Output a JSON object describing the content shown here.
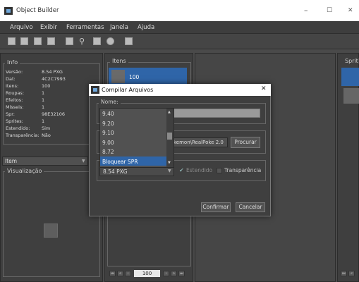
{
  "window": {
    "title": "Object Builder",
    "minimize": "–",
    "maximize": "☐",
    "close": "✕"
  },
  "menu": [
    "Arquivo",
    "Exibir",
    "Ferramentas",
    "Janela",
    "Ajuda"
  ],
  "toolbar_icons": [
    "new-file-icon",
    "open-folder-icon",
    "save-icon",
    "compile-icon",
    "find-icon",
    "search-icon",
    "grid-icon",
    "animation-icon",
    "image-icon"
  ],
  "info": {
    "title": "Info",
    "rows": [
      {
        "label": "Versão:",
        "value": "8.54 PXG"
      },
      {
        "label": "Dat:",
        "value": "4C2C7993"
      },
      {
        "label": "Itens:",
        "value": "100"
      },
      {
        "label": "Roupas:",
        "value": "1"
      },
      {
        "label": "Efeitos:",
        "value": "1"
      },
      {
        "label": "Mísseis:",
        "value": "1"
      },
      {
        "label": "Spr:",
        "value": "98E32106"
      },
      {
        "label": "Sprites:",
        "value": "1"
      },
      {
        "label": "Estendido:",
        "value": "Sim"
      },
      {
        "label": "Transparência:",
        "value": "Não"
      }
    ]
  },
  "category_combo": {
    "value": "Item"
  },
  "preview": {
    "title": "Visualização"
  },
  "items_panel": {
    "title": "Itens",
    "selected": "100",
    "page_input": "100"
  },
  "sprites_panel": {
    "title": "Sprit"
  },
  "nav": {
    "first": "⏮",
    "prev_fast": "«",
    "prev": "‹",
    "next": "›",
    "next_fast": "»",
    "last": "⏭"
  },
  "dialog": {
    "title": "Compilar Arquivos",
    "close": "✕",
    "name_label": "Nome:",
    "path_value": "kemon\\RealPoke 2.0",
    "browse_label": "Procurar",
    "version_value": "8.54 PXG",
    "extended_label": "Estendido",
    "transparency_label": "Transparência",
    "confirm_label": "Confirmar",
    "cancel_label": "Cancelar",
    "version_options": [
      "9.40",
      "9.20",
      "9.10",
      "9.00",
      "8.72",
      "Bloquear SPR"
    ],
    "highlighted_option": "Bloquear SPR"
  }
}
